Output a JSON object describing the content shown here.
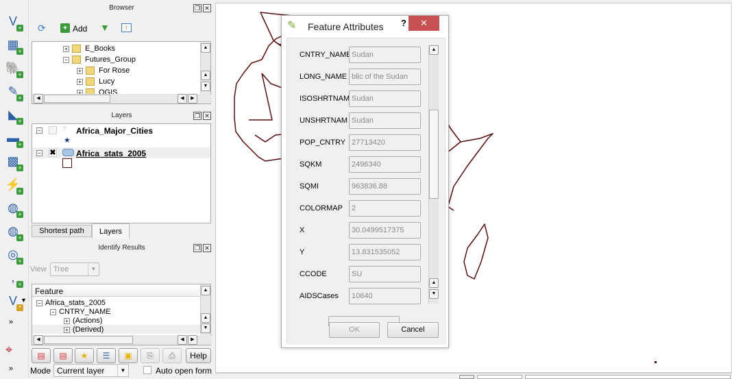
{
  "toolbar": {
    "icons": [
      "add-vector-layer",
      "add-raster-layer",
      "add-postgis-layer",
      "add-spatialite-layer",
      "add-mssql-layer",
      "add-oracle-layer",
      "add-wcs-layer",
      "add-wfs-layer",
      "add-wms-layer",
      "add-wfs-vector-layer",
      "add-delimited-text-layer",
      "new-shapefile-layer"
    ],
    "more": "»"
  },
  "browser": {
    "title": "Browser",
    "add_label": "Add",
    "items": [
      {
        "label": "E_Books",
        "expanded": false
      },
      {
        "label": "Futures_Group",
        "expanded": true
      },
      {
        "label": "For Rose",
        "expanded": false
      },
      {
        "label": "Lucy",
        "expanded": false
      },
      {
        "label": "QGIS",
        "expanded": false
      }
    ]
  },
  "layers": {
    "title": "Layers",
    "items": [
      {
        "label": "Africa_Major_Cities",
        "checked": false
      },
      {
        "label": "Africa_stats_2005",
        "checked": true
      }
    ],
    "tabs": [
      "Shortest path",
      "Layers"
    ]
  },
  "identify": {
    "title": "Identify Results",
    "view_label": "View",
    "view_value": "Tree",
    "column": "Feature",
    "tree": [
      "Africa_stats_2005",
      "CNTRY_NAME",
      "(Actions)",
      "(Derived)"
    ],
    "help": "Help",
    "mode_label": "Mode",
    "mode_value": "Current layer",
    "auto_open": "Auto open form"
  },
  "dialog": {
    "title": "Feature Attributes",
    "help": "?",
    "close": "✕",
    "fields": [
      {
        "name": "CNTRY_NAME",
        "value": "Sudan"
      },
      {
        "name": "LONG_NAME",
        "value": "blic of the Sudan"
      },
      {
        "name": "ISOSHRTNAM",
        "value": "Sudan"
      },
      {
        "name": "UNSHRTNAM",
        "value": "Sudan"
      },
      {
        "name": "POP_CNTRY",
        "value": "27713420"
      },
      {
        "name": "SQKM",
        "value": "2496340"
      },
      {
        "name": "SQMI",
        "value": "963836.88"
      },
      {
        "name": "COLORMAP",
        "value": "2"
      },
      {
        "name": "X",
        "value": "30.0499517375"
      },
      {
        "name": "Y",
        "value": "13.831535052"
      },
      {
        "name": "CCODE",
        "value": "SU"
      },
      {
        "name": "AIDSCases",
        "value": "10640"
      }
    ],
    "ok": "OK",
    "cancel": "Cancel"
  },
  "map": {
    "border_color": "#5a0a0a",
    "selection_fill": "#ff7b7b",
    "selection_stroke": "#ff0000",
    "selected_feature": "Sudan"
  }
}
